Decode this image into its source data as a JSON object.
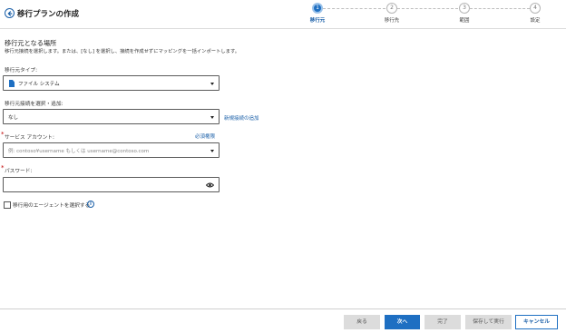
{
  "header": {
    "title": "移行プランの作成",
    "steps": [
      {
        "number": "1",
        "label": "移行元",
        "active": true
      },
      {
        "number": "2",
        "label": "移行先",
        "active": false
      },
      {
        "number": "3",
        "label": "範囲",
        "active": false
      },
      {
        "number": "4",
        "label": "設定",
        "active": false
      }
    ]
  },
  "main": {
    "section_title": "移行元となる場所",
    "section_description": "移行元接続を選択します。または、[なし] を選択し、接続を作成せずにマッピングを一括インポートします。",
    "source_type": {
      "label": "移行元タイプ:",
      "value": "ファイル システム",
      "icon": "file-icon"
    },
    "source_connection": {
      "label": "移行元接続を選択・追加:",
      "value": "なし",
      "new_link": "新規接続の追加"
    },
    "service_account": {
      "required_mark": "*",
      "label": "サービス アカウント:",
      "permission_link": "必須権限",
      "placeholder": "例: contoso¥username もしくは username@contoso.com"
    },
    "password": {
      "required_mark": "*",
      "label": "パスワード:",
      "value": "",
      "icon": "eye-icon"
    },
    "agent_checkbox": {
      "label": "移行用のエージェントを選択する",
      "checked": false,
      "icon": "info-icon",
      "info_glyph": "i"
    }
  },
  "footer": {
    "back": "戻る",
    "next": "次へ",
    "finish": "完了",
    "save_run": "保存して実行",
    "cancel": "キャンセル"
  }
}
